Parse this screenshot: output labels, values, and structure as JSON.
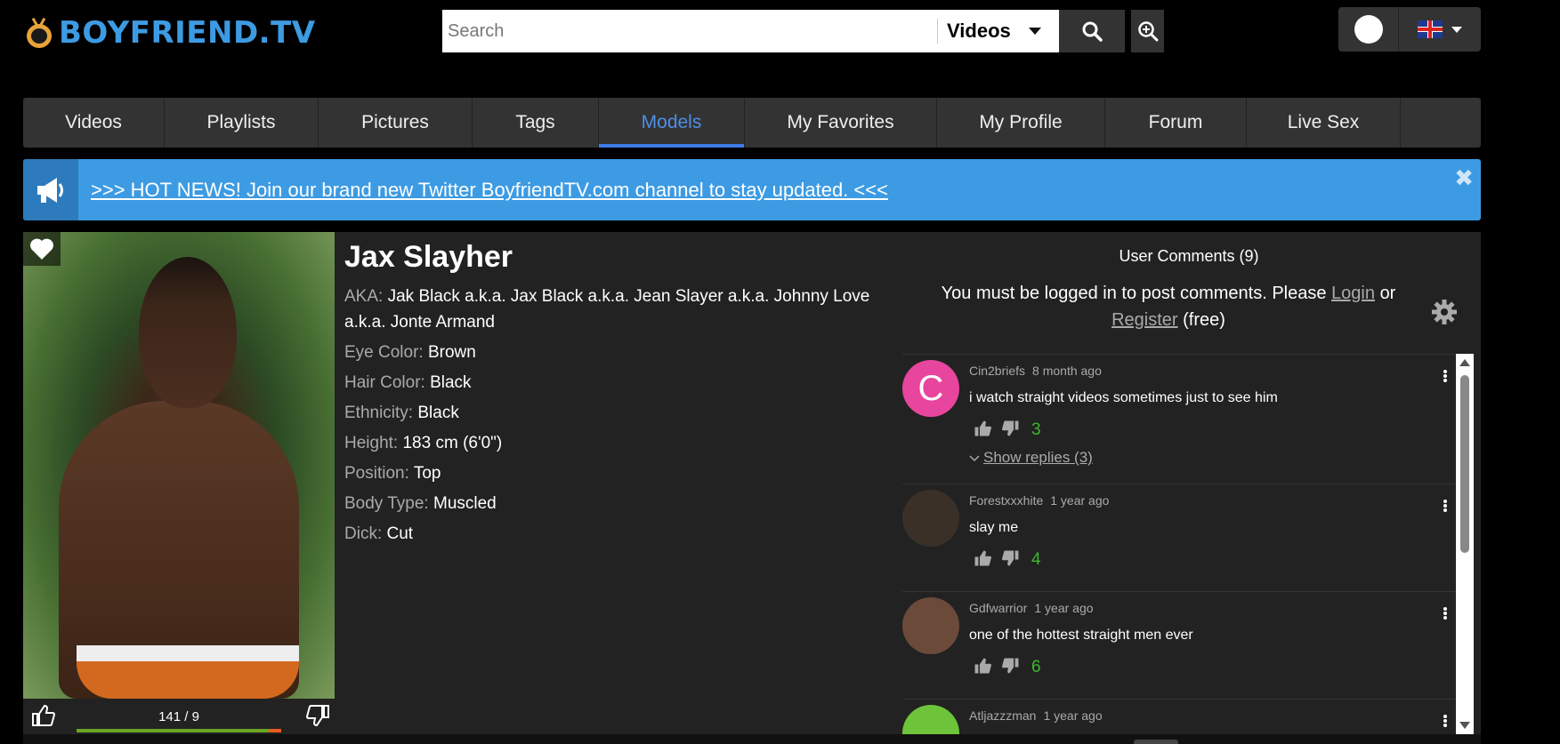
{
  "header": {
    "logo_text": "BOYFRIEND.TV",
    "search_placeholder": "Search",
    "search_type": "Videos"
  },
  "nav": {
    "items": [
      {
        "label": "Videos",
        "width": 159
      },
      {
        "label": "Playlists",
        "width": 173
      },
      {
        "label": "Pictures",
        "width": 173
      },
      {
        "label": "Tags",
        "width": 142
      },
      {
        "label": "Models",
        "width": 164,
        "active": true
      },
      {
        "label": "My Favorites",
        "width": 216
      },
      {
        "label": "My Profile",
        "width": 189
      },
      {
        "label": "Forum",
        "width": 159
      },
      {
        "label": "Live Sex",
        "width": 173
      }
    ]
  },
  "news": {
    "text": ">>> HOT NEWS! Join our brand new Twitter BoyfriendTV.com channel to stay updated. <<<",
    "close": "✖"
  },
  "model": {
    "name": "Jax Slayher",
    "aka_label": "AKA:",
    "aka_value": "Jak Black a.k.a. Jax Black a.k.a. Jean Slayer a.k.a. Johnny Love a.k.a. Jonte Armand",
    "fields": [
      {
        "label": "Eye Color:",
        "value": "Brown"
      },
      {
        "label": "Hair Color:",
        "value": "Black"
      },
      {
        "label": "Ethnicity:",
        "value": "Black"
      },
      {
        "label": "Height:",
        "value": "183 cm (6'0\")"
      },
      {
        "label": "Position:",
        "value": "Top"
      },
      {
        "label": "Body Type:",
        "value": "Muscled"
      },
      {
        "label": "Dick:",
        "value": "Cut"
      }
    ],
    "rating_text": "141 / 9",
    "rating_fraction": 0.94
  },
  "comments": {
    "title": "User Comments (9)",
    "login_prefix": "You must be logged in to post comments. Please",
    "login_link": "Login",
    "or": "or",
    "register_link": "Register",
    "free": "(free)",
    "items": [
      {
        "user": "Cin2briefs",
        "time": "8 month ago",
        "text": "i watch straight videos sometimes just to see him",
        "score": "3",
        "replies": "Show replies (3)",
        "avatar_letter": "C",
        "avatar_color": "#e8459e"
      },
      {
        "user": "Forestxxxhite",
        "time": "1 year ago",
        "text": "slay me",
        "score": "4",
        "replies": "",
        "avatar_letter": "",
        "avatar_color": "#3a3028"
      },
      {
        "user": "Gdfwarrior",
        "time": "1 year ago",
        "text": "one of the hottest straight men ever",
        "score": "6",
        "replies": "",
        "avatar_letter": "",
        "avatar_color": "#6b4a3a"
      },
      {
        "user": "Atljazzzman",
        "time": "1 year ago",
        "text": "",
        "score": "",
        "replies": "",
        "avatar_letter": "",
        "avatar_color": "#6dc33a"
      }
    ]
  }
}
